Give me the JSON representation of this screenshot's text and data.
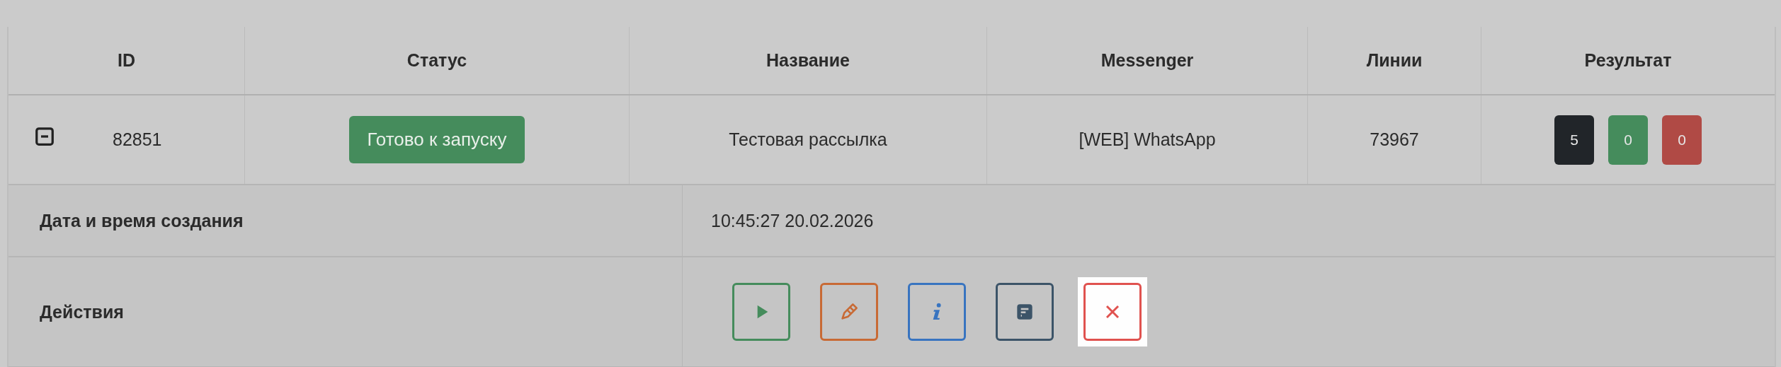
{
  "table": {
    "columns": [
      "ID",
      "Статус",
      "Название",
      "Messenger",
      "Линии",
      "Результат"
    ],
    "rows": [
      {
        "expanded": true,
        "id": "82851",
        "status": "Готово к запуску",
        "name": "Тестовая рассылка",
        "messenger": "[WEB] WhatsApp",
        "lines": "73967",
        "results": [
          {
            "value": "5",
            "color": "#212529"
          },
          {
            "value": "0",
            "color": "#458c5c"
          },
          {
            "value": "0",
            "color": "#b04a45"
          }
        ],
        "details": [
          {
            "label": "Дата и время создания",
            "value": "10:45:27 20.02.2026"
          },
          {
            "label": "Действия",
            "actions": [
              {
                "kind": "play",
                "color": "#458c5c",
                "highlighted": false
              },
              {
                "kind": "edit",
                "color": "#c86a35",
                "highlighted": false
              },
              {
                "kind": "info",
                "color": "#3874c0",
                "highlighted": false
              },
              {
                "kind": "report",
                "color": "#3c5468",
                "highlighted": false
              },
              {
                "kind": "delete",
                "color": "#e0524f",
                "highlighted": true
              }
            ]
          }
        ]
      }
    ]
  }
}
